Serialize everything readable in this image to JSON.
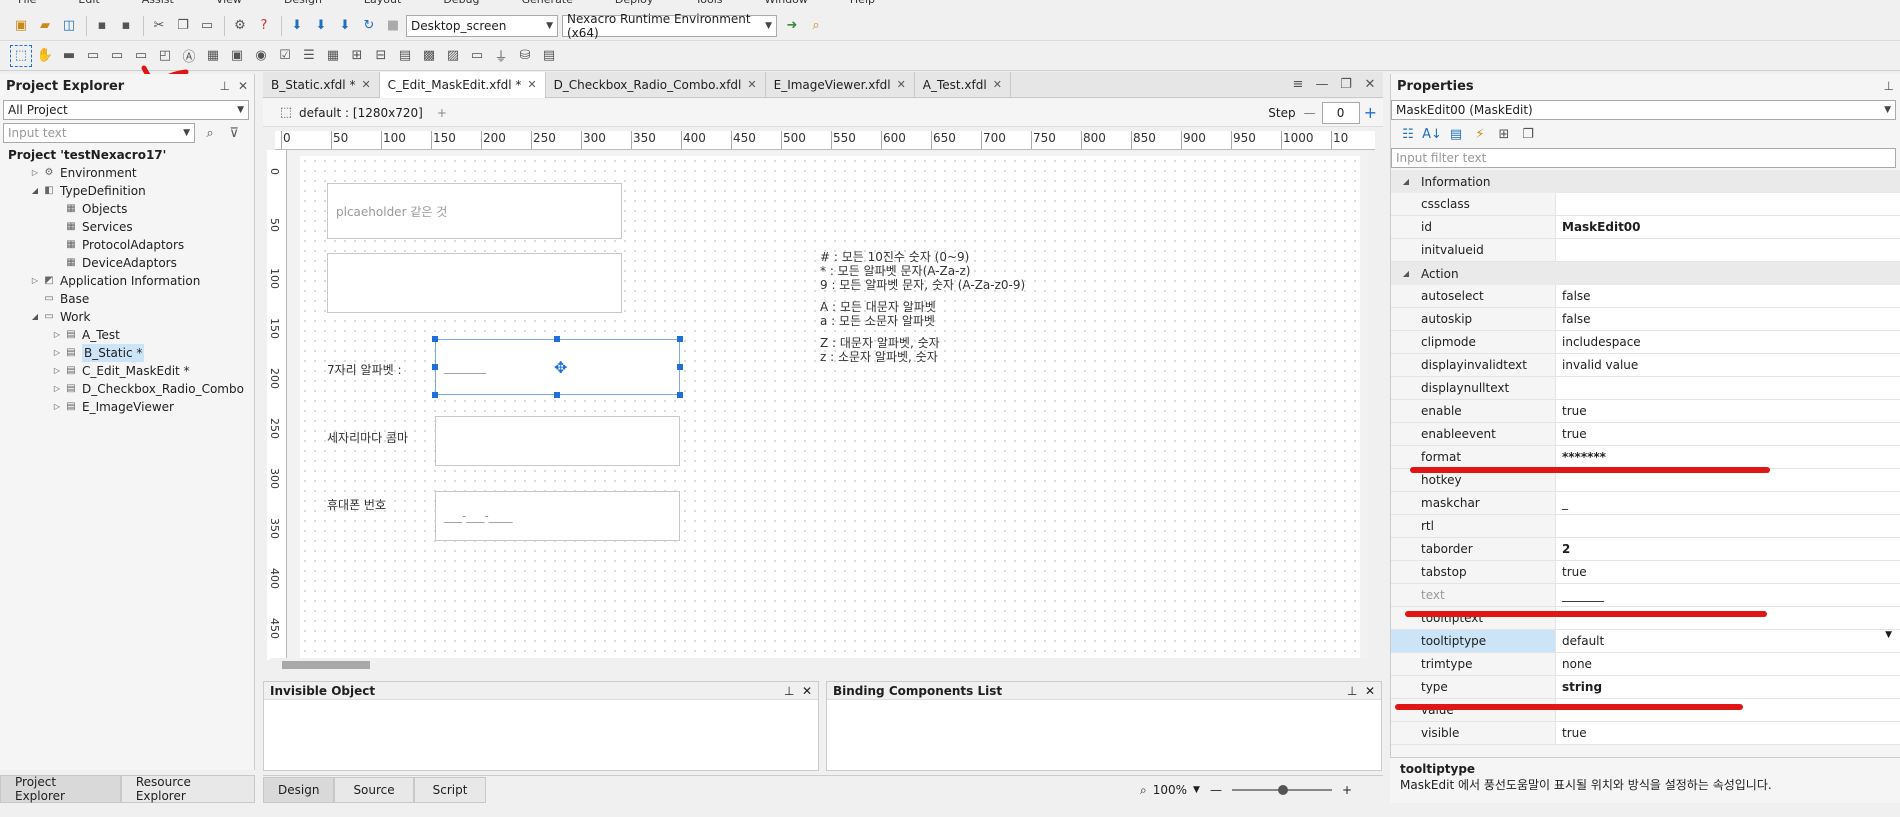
{
  "menu": [
    "File",
    "Edit",
    "Assist",
    "View",
    "Design",
    "Layout",
    "Debug",
    "Generate",
    "Deploy",
    "Tools",
    "Window",
    "Help"
  ],
  "toolbar": {
    "screen_combo": "Desktop_screen",
    "env_combo": "Nexacro Runtime Environment (x64)"
  },
  "left_panel": {
    "title": "Project Explorer",
    "filter_combo": "All Project",
    "search_placeholder": "Input text",
    "tree": [
      {
        "label": "Project 'testNexacro17'",
        "level": 0,
        "bold": true,
        "icon": "project-icon",
        "expanded": true
      },
      {
        "label": "Environment",
        "level": 1,
        "icon": "gear-icon",
        "expanded": false
      },
      {
        "label": "TypeDefinition",
        "level": 1,
        "icon": "typedef-icon",
        "expanded": true
      },
      {
        "label": "Objects",
        "level": 2,
        "icon": "grid-icon"
      },
      {
        "label": "Services",
        "level": 2,
        "icon": "grid-icon"
      },
      {
        "label": "ProtocolAdaptors",
        "level": 2,
        "icon": "grid-icon"
      },
      {
        "label": "DeviceAdaptors",
        "level": 2,
        "icon": "grid-icon"
      },
      {
        "label": "Application Information",
        "level": 1,
        "icon": "app-icon",
        "expanded": false
      },
      {
        "label": "Base",
        "level": 1,
        "icon": "folder-icon"
      },
      {
        "label": "Work",
        "level": 1,
        "icon": "folder-icon",
        "expanded": true
      },
      {
        "label": "A_Test",
        "level": 2,
        "icon": "form-icon",
        "expanded": false
      },
      {
        "label": "B_Static *",
        "level": 2,
        "icon": "form-icon",
        "expanded": false,
        "selected": true
      },
      {
        "label": "C_Edit_MaskEdit *",
        "level": 2,
        "icon": "form-icon",
        "expanded": false
      },
      {
        "label": "D_Checkbox_Radio_Combo",
        "level": 2,
        "icon": "form-icon",
        "expanded": false
      },
      {
        "label": "E_ImageViewer",
        "level": 2,
        "icon": "form-icon",
        "expanded": false
      }
    ],
    "bottom_tabs": [
      "Project Explorer",
      "Resource Explorer"
    ]
  },
  "editor": {
    "tabs": [
      "B_Static.xfdl *",
      "C_Edit_MaskEdit.xfdl *",
      "D_Checkbox_Radio_Combo.xfdl",
      "E_ImageViewer.xfdl",
      "A_Test.xfdl"
    ],
    "layout_label": "default : [1280x720]",
    "add_label": "+",
    "step_label": "Step",
    "step_value": "0",
    "ruler_h": [
      "0",
      "50",
      "100",
      "150",
      "200",
      "250",
      "300",
      "350",
      "400",
      "450",
      "500",
      "550",
      "600",
      "650",
      "700",
      "750",
      "800",
      "850",
      "900",
      "950",
      "1000",
      "10"
    ],
    "ruler_v": [
      "0",
      "50",
      "100",
      "150",
      "200",
      "250",
      "300",
      "350",
      "400",
      "450"
    ],
    "placeholder_box": "plcaeholder 같은 것",
    "label_7": "7자리 알파벳 :",
    "mask_7": "_______",
    "label_comma": "세자리마다 콤마",
    "label_phone": "휴대폰 번호",
    "mask_phone": "___-___-____",
    "notes": [
      "# : 모든 10진수 숫자 (0~9)",
      "* : 모든 알파벳 문자(A-Za-z)",
      "9 : 모든 알파벳 문자, 숫자 (A-Za-z0-9)",
      "",
      "A : 모든 대문자 알파벳",
      "a : 모든 소문자 알파벳",
      "",
      "Z : 대문자 알파벳, 숫자",
      "z : 소문자 알파벳, 숫자"
    ],
    "bottom_left_title": "Invisible Object",
    "bottom_right_title": "Binding Components List",
    "view_tabs": [
      "Design",
      "Source",
      "Script"
    ],
    "zoom": "100%"
  },
  "properties": {
    "title": "Properties",
    "object": "MaskEdit00  (MaskEdit)",
    "filter_placeholder": "Input filter text",
    "categories": [
      {
        "name": "Information",
        "rows": [
          {
            "k": "cssclass",
            "v": ""
          },
          {
            "k": "id",
            "v": "MaskEdit00",
            "bold": true
          },
          {
            "k": "initvalueid",
            "v": ""
          }
        ]
      },
      {
        "name": "Action",
        "rows": [
          {
            "k": "autoselect",
            "v": "false"
          },
          {
            "k": "autoskip",
            "v": "false"
          },
          {
            "k": "clipmode",
            "v": "includespace"
          },
          {
            "k": "displayinvalidtext",
            "v": "invalid value"
          },
          {
            "k": "displaynulltext",
            "v": ""
          },
          {
            "k": "enable",
            "v": "true"
          },
          {
            "k": "enableevent",
            "v": "true"
          },
          {
            "k": "format",
            "v": "*******",
            "bold": true
          },
          {
            "k": "hotkey",
            "v": ""
          },
          {
            "k": "maskchar",
            "v": "_"
          },
          {
            "k": "rtl",
            "v": ""
          },
          {
            "k": "taborder",
            "v": "2",
            "bold": true
          },
          {
            "k": "tabstop",
            "v": "true"
          },
          {
            "k": "text",
            "v": "_______",
            "grey": true
          },
          {
            "k": "tooltiptext",
            "v": ""
          },
          {
            "k": "tooltiptype",
            "v": "default",
            "highlight": true
          },
          {
            "k": "trimtype",
            "v": "none"
          },
          {
            "k": "type",
            "v": "string",
            "bold": true
          },
          {
            "k": "value",
            "v": ""
          },
          {
            "k": "visible",
            "v": "true"
          }
        ]
      }
    ],
    "desc_title": "tooltiptype",
    "desc_text": "MaskEdit 에서 풍선도움말이 표시될 위치와 방식을 설정하는 속성입니다."
  },
  "colors": {
    "accent": "#1e6fd8",
    "annotation_red": "#e01515",
    "selection": "#cce4f7"
  }
}
